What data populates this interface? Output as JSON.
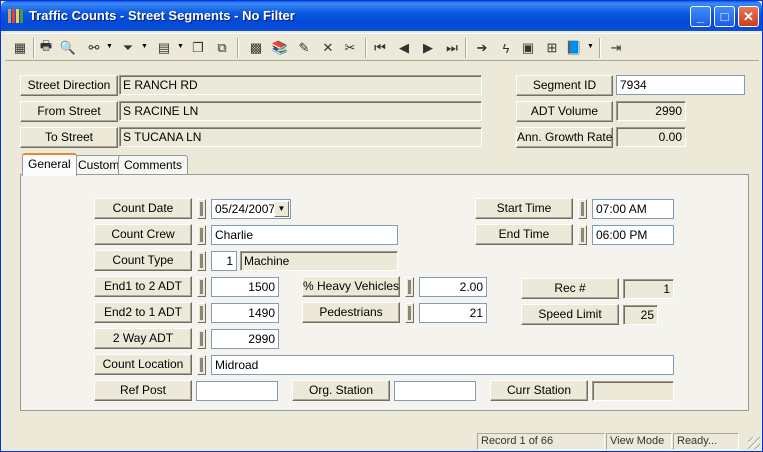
{
  "window": {
    "title": "Traffic Counts - Street Segments - No Filter",
    "minimize": "_",
    "maximize": "□",
    "close": "✕"
  },
  "toolbar": {
    "icons": [
      "new-record-icon",
      "print-icon",
      "print-preview-icon",
      "binoculars-icon",
      "filter-icon",
      "report-icon",
      "copy-icon",
      "paste-icon",
      "grid-icon",
      "books-icon",
      "edit-pencil-icon",
      "delete-icon",
      "cut-icon",
      "first-record-icon",
      "previous-record-icon",
      "next-record-icon",
      "last-record-icon",
      "goto-arrow-icon",
      "lightning-icon",
      "calculator-icon",
      "tree-icon",
      "books-stack-icon",
      "exit-icon"
    ]
  },
  "header": {
    "street_direction": {
      "label": "Street Direction",
      "value": "E RANCH RD"
    },
    "from_street": {
      "label": "From Street",
      "value": "S RACINE LN"
    },
    "to_street": {
      "label": "To Street",
      "value": "S TUCANA LN"
    },
    "segment_id": {
      "label": "Segment ID",
      "value": "7934"
    },
    "adt_volume": {
      "label": "ADT Volume",
      "value": "2990"
    },
    "ann_growth_rate": {
      "label": "Ann. Growth Rate",
      "value": "0.00"
    }
  },
  "tabs": [
    {
      "label": "General",
      "active": true
    },
    {
      "label": "Custom",
      "active": false
    },
    {
      "label": "Comments",
      "active": false
    }
  ],
  "general": {
    "count_date": {
      "label": "Count Date",
      "value": "05/24/2007"
    },
    "count_crew": {
      "label": "Count Crew",
      "value": "Charlie"
    },
    "count_type": {
      "label": "Count Type",
      "code": "1",
      "value": "Machine"
    },
    "end1_to_2": {
      "label": "End1 to 2 ADT",
      "value": "1500"
    },
    "end2_to_1": {
      "label": "End2 to 1 ADT",
      "value": "1490"
    },
    "two_way": {
      "label": "2 Way ADT",
      "value": "2990"
    },
    "count_location": {
      "label": "Count Location",
      "value": "Midroad"
    },
    "ref_post": {
      "label": "Ref Post",
      "value": ""
    },
    "org_station": {
      "label": "Org. Station",
      "value": ""
    },
    "curr_station": {
      "label": "Curr Station",
      "value": ""
    },
    "heavy_vehicles": {
      "label": "% Heavy Vehicles",
      "value": "2.00"
    },
    "pedestrians": {
      "label": "Pedestrians",
      "value": "21"
    },
    "start_time": {
      "label": "Start Time",
      "value": "07:00 AM"
    },
    "end_time": {
      "label": "End Time",
      "value": "06:00 PM"
    },
    "rec_num": {
      "label": "Rec #",
      "value": "1"
    },
    "speed_limit": {
      "label": "Speed Limit",
      "value": "25"
    }
  },
  "status": {
    "record": "Record 1 of 66",
    "mode": "View Mode",
    "state": "Ready..."
  }
}
